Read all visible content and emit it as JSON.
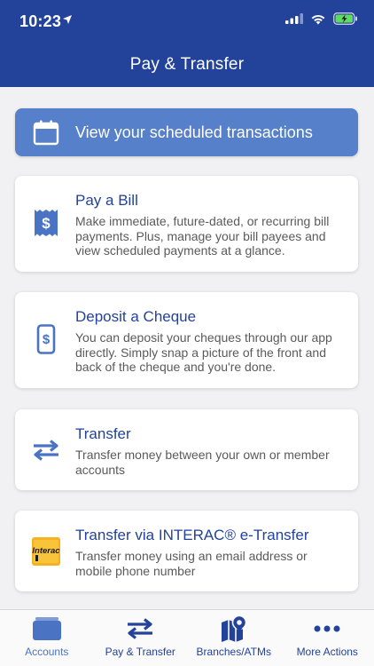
{
  "status_bar": {
    "time": "10:23"
  },
  "header": {
    "title": "Pay & Transfer"
  },
  "scheduled": {
    "label": "View your scheduled transactions",
    "icon": "calendar-icon"
  },
  "cards": [
    {
      "title": "Pay a Bill",
      "description": "Make immediate, future-dated, or recurring bill payments. Plus, manage your bill payees and view scheduled payments at a glance.",
      "icon": "bill-icon"
    },
    {
      "title": "Deposit a Cheque",
      "description": "You can deposit your cheques through our app directly. Simply snap a picture of the front and back of the cheque and you're done.",
      "icon": "phone-deposit-icon"
    },
    {
      "title": "Transfer",
      "description": "Transfer money between your own or member accounts",
      "icon": "transfer-arrows-icon"
    },
    {
      "title": "Transfer via INTERAC® e-Transfer",
      "description": "Transfer money using an email address or mobile phone number",
      "icon": "interac-logo-icon",
      "logo_text": "Interac"
    }
  ],
  "tabbar": {
    "items": [
      {
        "label": "Accounts",
        "icon": "wallet-icon"
      },
      {
        "label": "Pay & Transfer",
        "icon": "transfer-arrows-icon"
      },
      {
        "label": "Branches/ATMs",
        "icon": "map-pin-icon"
      },
      {
        "label": "More Actions",
        "icon": "more-dots-icon"
      }
    ]
  },
  "colors": {
    "brand": "#23429a",
    "accent": "#5680c9",
    "background": "#f1f1f3",
    "interac": "#f5b21f"
  }
}
